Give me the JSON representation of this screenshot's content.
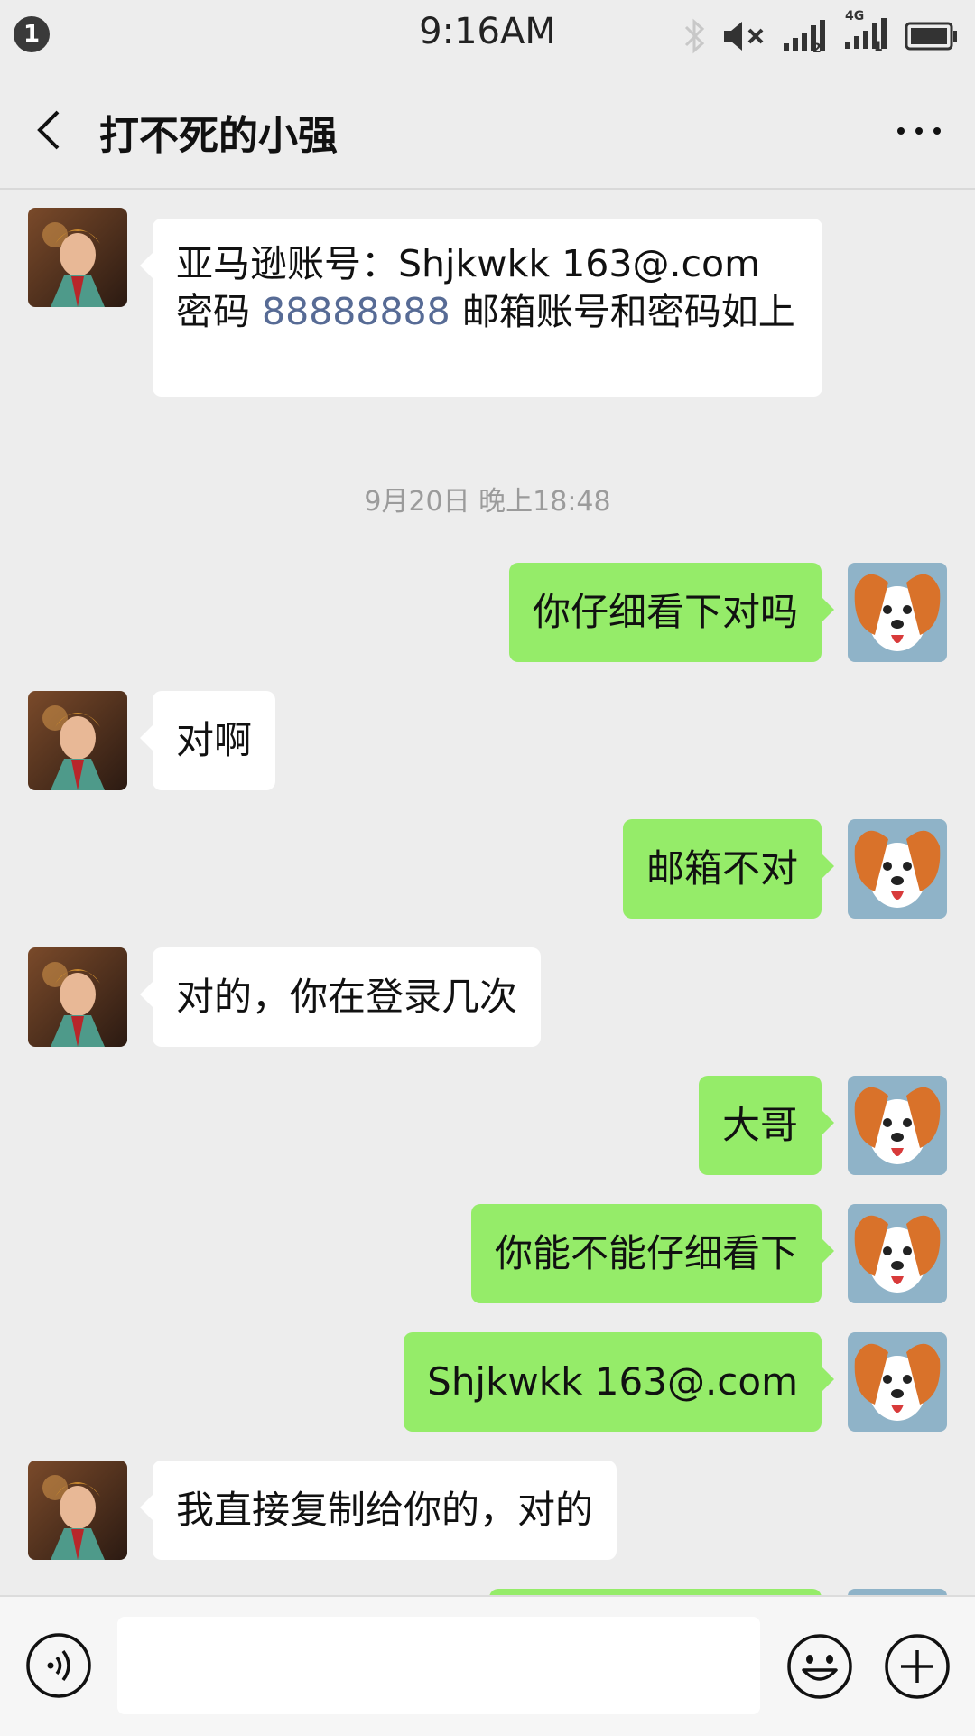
{
  "status_bar": {
    "notification_count": "1",
    "time": "9:16AM",
    "network_label": "4G"
  },
  "header": {
    "title": "打不死的小强"
  },
  "messages": [
    {
      "side": "left",
      "parts": [
        {
          "text": "亚马逊账号：Shjkwkk 163@.com 密码 "
        },
        {
          "text": "88888888",
          "link": true
        },
        {
          "text": " 邮箱账号和密码如上"
        }
      ]
    },
    {
      "type": "timestamp",
      "text": "9月20日 晚上18:48"
    },
    {
      "side": "right",
      "text": "你仔细看下对吗"
    },
    {
      "side": "left",
      "text": "对啊"
    },
    {
      "side": "right",
      "text": "邮箱不对"
    },
    {
      "side": "left",
      "text": "对的，你在登录几次"
    },
    {
      "side": "right",
      "text": "大哥"
    },
    {
      "side": "right",
      "text": "你能不能仔细看下"
    },
    {
      "side": "right",
      "text": "Shjkwkk 163@.com"
    },
    {
      "side": "left",
      "text": "我直接复制给你的，对的"
    }
  ],
  "input_bar": {
    "placeholder": "",
    "value": ""
  },
  "colors": {
    "background": "#ededed",
    "sent_bubble": "#95ec69",
    "received_bubble": "#ffffff",
    "link": "#576b95"
  }
}
